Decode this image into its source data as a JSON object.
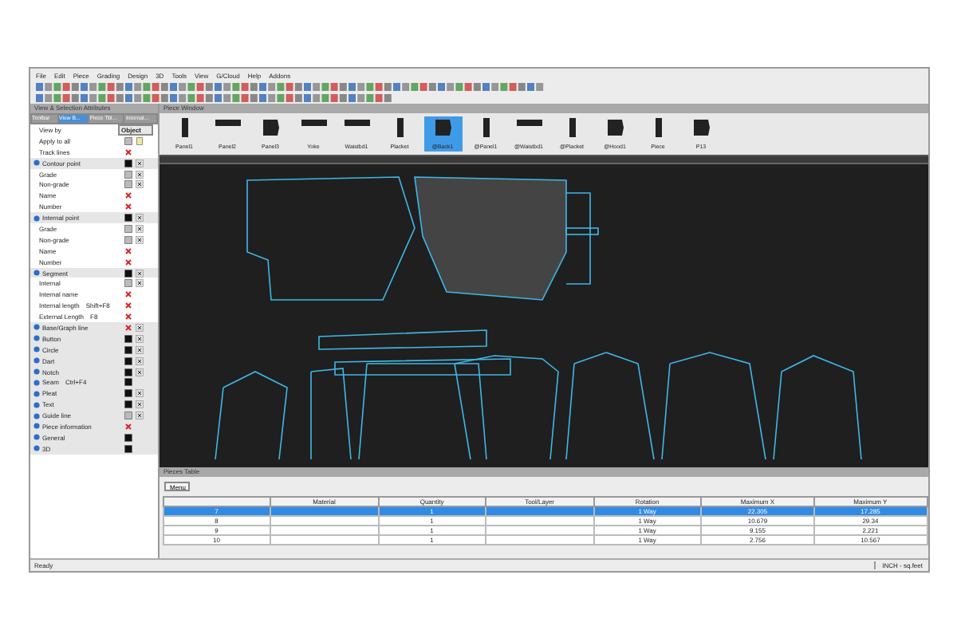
{
  "menu": [
    "File",
    "Edit",
    "Piece",
    "Grading",
    "Design",
    "3D",
    "Tools",
    "View",
    "G/Cloud",
    "Help",
    "Addons"
  ],
  "left_panel": {
    "title": "View & Selection Attributes",
    "tabs": [
      {
        "label": "Toolbar",
        "selected": false
      },
      {
        "label": "View B...",
        "selected": true
      },
      {
        "label": "Piece Tbl...",
        "selected": false
      },
      {
        "label": "Internal...",
        "selected": false
      }
    ],
    "view_by": {
      "label": "View by",
      "value": "Object"
    },
    "rows": [
      {
        "label": "Apply to all",
        "section": false,
        "toggles": [
          {
            "kind": "outline"
          },
          {
            "kind": "page"
          }
        ]
      },
      {
        "label": "Track lines",
        "section": false,
        "toggles": [
          {
            "kind": "hidden"
          }
        ]
      },
      {
        "label": "Contour point",
        "section": true,
        "toggles": [
          {
            "kind": "fill"
          },
          {
            "kind": "remove"
          }
        ]
      },
      {
        "label": "Grade",
        "section": false,
        "toggles": [
          {
            "kind": "outline"
          },
          {
            "kind": "remove"
          }
        ]
      },
      {
        "label": "Non-grade",
        "section": false,
        "toggles": [
          {
            "kind": "outline"
          },
          {
            "kind": "remove"
          }
        ]
      },
      {
        "label": "Name",
        "section": false,
        "toggles": [
          {
            "kind": "hidden"
          }
        ]
      },
      {
        "label": "Number",
        "section": false,
        "toggles": [
          {
            "kind": "hidden"
          }
        ]
      },
      {
        "label": "Internal point",
        "section": true,
        "toggles": [
          {
            "kind": "fill"
          },
          {
            "kind": "remove"
          }
        ]
      },
      {
        "label": "Grade",
        "section": false,
        "toggles": [
          {
            "kind": "outline"
          },
          {
            "kind": "remove"
          }
        ]
      },
      {
        "label": "Non-grade",
        "section": false,
        "toggles": [
          {
            "kind": "outline"
          },
          {
            "kind": "remove"
          }
        ]
      },
      {
        "label": "Name",
        "section": false,
        "toggles": [
          {
            "kind": "hidden"
          }
        ]
      },
      {
        "label": "Number",
        "section": false,
        "toggles": [
          {
            "kind": "hidden"
          }
        ]
      },
      {
        "label": "Segment",
        "section": true,
        "toggles": [
          {
            "kind": "fill"
          },
          {
            "kind": "remove"
          }
        ]
      },
      {
        "label": "Internal",
        "section": false,
        "toggles": [
          {
            "kind": "outline"
          },
          {
            "kind": "remove"
          }
        ]
      },
      {
        "label": "Internal name",
        "section": false,
        "toggles": [
          {
            "kind": "hidden"
          }
        ]
      },
      {
        "label": "Internal length",
        "shortcut": "Shift+F8",
        "section": false,
        "toggles": [
          {
            "kind": "hidden"
          }
        ]
      },
      {
        "label": "External Length",
        "shortcut": "F8",
        "section": false,
        "toggles": [
          {
            "kind": "hidden"
          }
        ]
      },
      {
        "label": "Base/Graph line",
        "section": true,
        "toggles": [
          {
            "kind": "hidden"
          },
          {
            "kind": "remove"
          }
        ]
      },
      {
        "label": "Button",
        "section": true,
        "toggles": [
          {
            "kind": "fill"
          },
          {
            "kind": "remove"
          }
        ]
      },
      {
        "label": "Circle",
        "section": true,
        "toggles": [
          {
            "kind": "fill"
          },
          {
            "kind": "remove"
          }
        ]
      },
      {
        "label": "Dart",
        "section": true,
        "toggles": [
          {
            "kind": "fill"
          },
          {
            "kind": "remove"
          }
        ]
      },
      {
        "label": "Notch",
        "section": true,
        "toggles": [
          {
            "kind": "fill"
          },
          {
            "kind": "remove"
          }
        ]
      },
      {
        "label": "Seam",
        "shortcut": "Ctrl+F4",
        "section": true,
        "toggles": [
          {
            "kind": "fill"
          }
        ]
      },
      {
        "label": "Pleat",
        "section": true,
        "toggles": [
          {
            "kind": "fill"
          },
          {
            "kind": "remove"
          }
        ]
      },
      {
        "label": "Text",
        "section": true,
        "toggles": [
          {
            "kind": "fill"
          },
          {
            "kind": "remove"
          }
        ]
      },
      {
        "label": "Guide line",
        "section": true,
        "toggles": [
          {
            "kind": "outline"
          },
          {
            "kind": "remove"
          }
        ]
      },
      {
        "label": "Piece information",
        "section": true,
        "toggles": [
          {
            "kind": "hidden"
          }
        ]
      },
      {
        "label": "General",
        "section": true,
        "toggles": [
          {
            "kind": "fill"
          }
        ]
      },
      {
        "label": "3D",
        "section": true,
        "toggles": [
          {
            "kind": "fill"
          }
        ]
      }
    ]
  },
  "piece_window": {
    "title": "Piece Window",
    "pieces": [
      {
        "label": "Panel1",
        "selected": false,
        "kind": "tall"
      },
      {
        "label": "Panel2",
        "selected": false,
        "kind": "wide"
      },
      {
        "label": "Panel3",
        "selected": false,
        "kind": "block"
      },
      {
        "label": "Yoke",
        "selected": false,
        "kind": "wide"
      },
      {
        "label": "Waistbd1",
        "selected": false,
        "kind": "wide"
      },
      {
        "label": "Placket",
        "selected": false,
        "kind": "tall"
      },
      {
        "label": "@Back1",
        "selected": true,
        "kind": "block"
      },
      {
        "label": "@Panel1",
        "selected": false,
        "kind": "tall"
      },
      {
        "label": "@Waistbd1",
        "selected": false,
        "kind": "wide"
      },
      {
        "label": "@Placket",
        "selected": false,
        "kind": "tall"
      },
      {
        "label": "@Hood1",
        "selected": false,
        "kind": "block"
      },
      {
        "label": "Piece",
        "selected": false,
        "kind": "tall"
      },
      {
        "label": "P13",
        "selected": false,
        "kind": "block"
      }
    ]
  },
  "pieces_table": {
    "title": "Pieces Table",
    "menu_button": "Menu",
    "columns": [
      "Material",
      "Quantity",
      "Tool/Layer",
      "Rotation",
      "Maximum X",
      "Maximum Y"
    ],
    "rows": [
      {
        "id": "7",
        "selected": true,
        "cells": [
          "",
          "1",
          "",
          "1 Way",
          "22.305",
          "17.285"
        ]
      },
      {
        "id": "8",
        "selected": false,
        "cells": [
          "",
          "1",
          "",
          "1 Way",
          "10.679",
          "29.34"
        ]
      },
      {
        "id": "9",
        "selected": false,
        "cells": [
          "",
          "1",
          "",
          "1 Way",
          "9.155",
          "2.221"
        ]
      },
      {
        "id": "10",
        "selected": false,
        "cells": [
          "",
          "1",
          "",
          "1 Way",
          "2.756",
          "10.567"
        ]
      }
    ]
  },
  "status_bar": {
    "left": "Ready",
    "units": "INCH - sq.feet"
  }
}
